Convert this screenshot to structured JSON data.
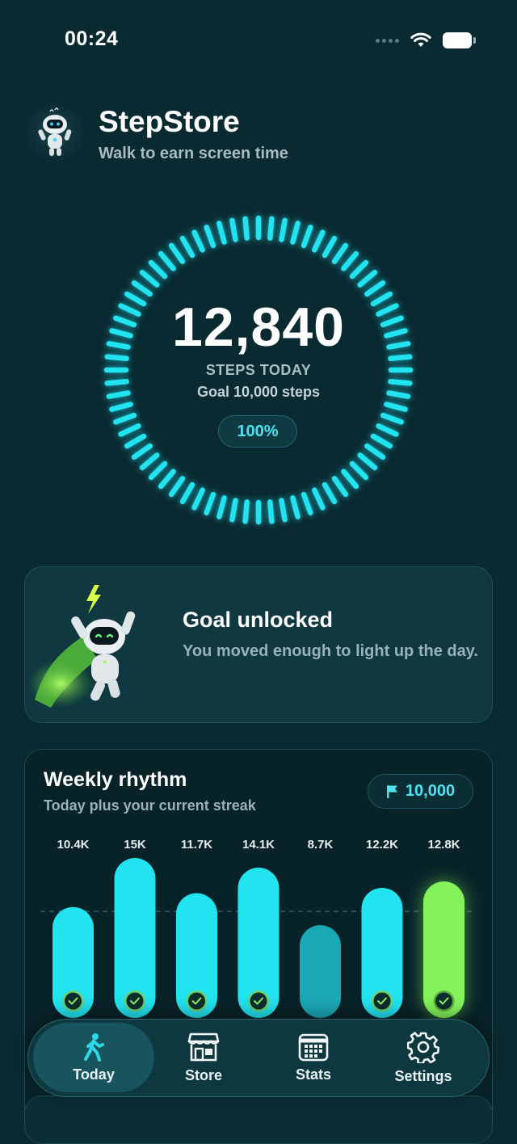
{
  "status_bar": {
    "time": "00:24",
    "icons": [
      "signal-dots-icon",
      "wifi-icon",
      "battery-icon"
    ]
  },
  "header": {
    "title": "StepStore",
    "subtitle": "Walk to earn screen time",
    "avatar": "robot-mascot"
  },
  "progress": {
    "steps": "12,840",
    "label": "STEPS TODAY",
    "goal_text": "Goal 10,000 steps",
    "percent_label": "100%",
    "fraction": 1.0
  },
  "goal_card": {
    "title": "Goal unlocked",
    "description": "You moved enough to light up the day.",
    "illustration": "robot-celebrating-lightning"
  },
  "weekly": {
    "title": "Weekly rhythm",
    "subtitle": "Today plus your current streak",
    "goal_chip": "10,000",
    "goal_chip_icon": "flag-icon"
  },
  "chart_data": {
    "type": "bar",
    "categories": [
      "",
      "",
      "",
      "",
      "",
      "",
      ""
    ],
    "values": [
      10400,
      15000,
      11700,
      14100,
      8700,
      12200,
      12800
    ],
    "labels": [
      "10.4K",
      "15K",
      "11.7K",
      "14.1K",
      "8.7K",
      "12.2K",
      "12.8K"
    ],
    "goal_met": [
      true,
      true,
      true,
      true,
      false,
      true,
      true
    ],
    "today_index": 6,
    "goal_line": 10000,
    "ylim": [
      0,
      15000
    ],
    "colors": {
      "met": "#22e3f0",
      "missed": "#1ba8b6",
      "today": "#84f25a"
    }
  },
  "nav": {
    "items": [
      {
        "label": "Today",
        "icon": "walking-person-icon",
        "active": true
      },
      {
        "label": "Store",
        "icon": "storefront-icon",
        "active": false
      },
      {
        "label": "Stats",
        "icon": "calendar-grid-icon",
        "active": false
      },
      {
        "label": "Settings",
        "icon": "gear-icon",
        "active": false
      }
    ]
  },
  "colors": {
    "background": "#0a2a32",
    "accent": "#22e3f0",
    "today": "#84f25a"
  }
}
